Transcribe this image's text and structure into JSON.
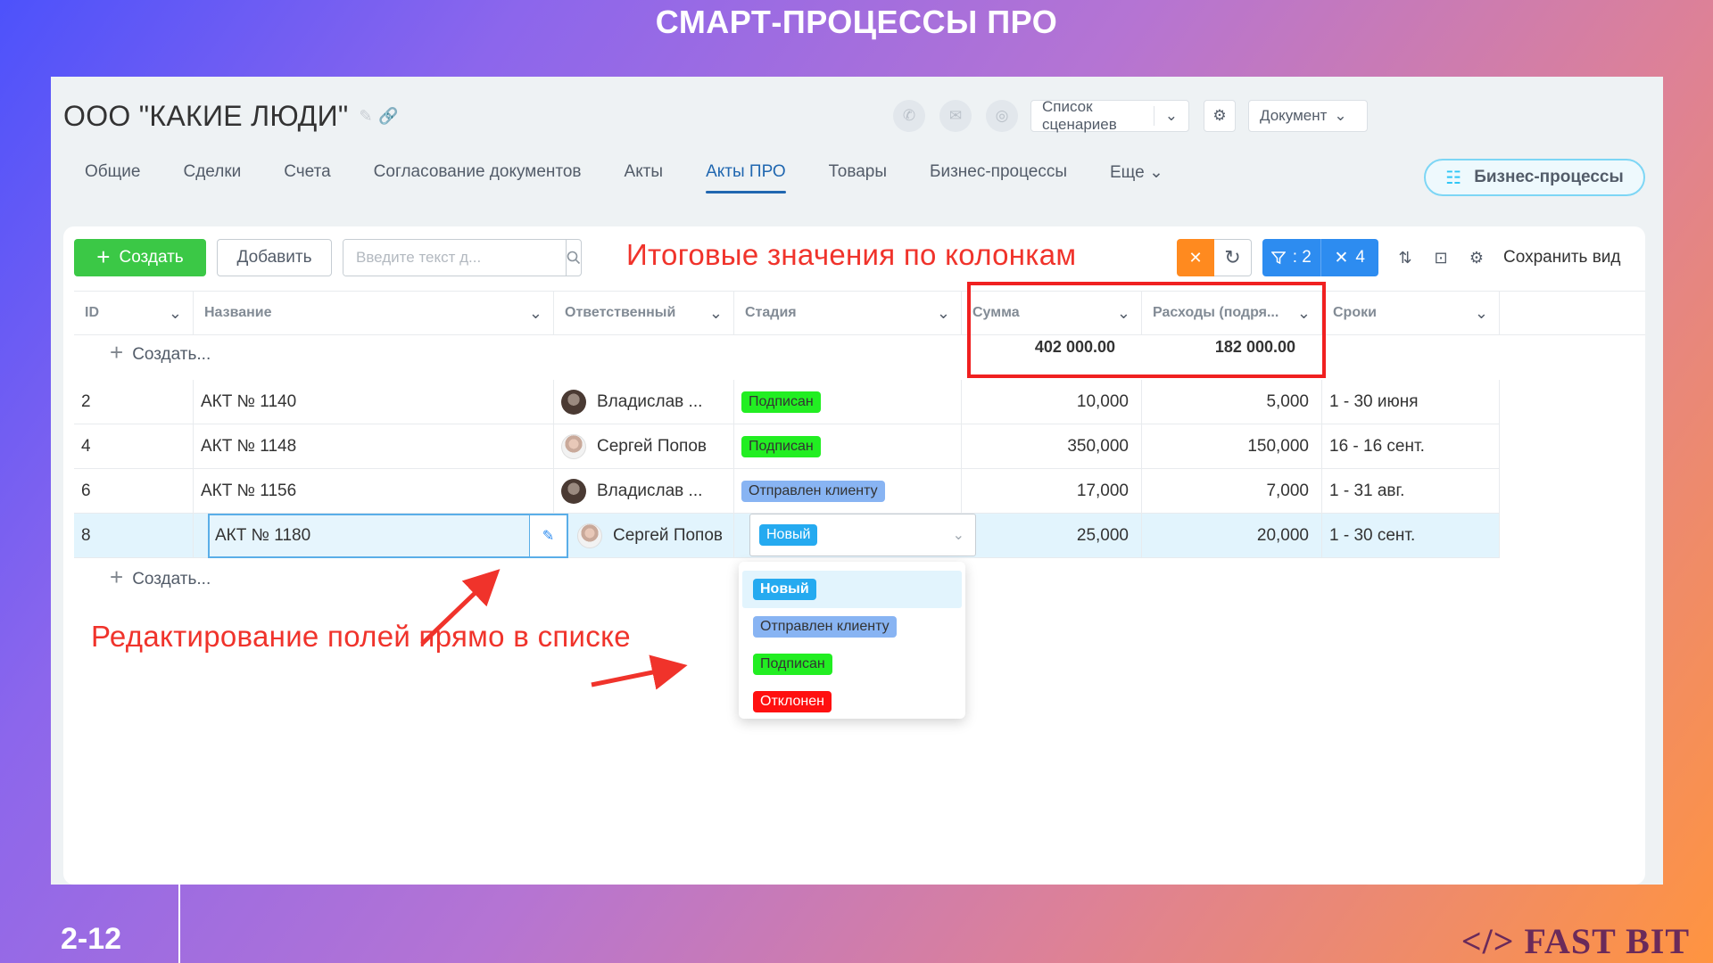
{
  "slide": {
    "title": "СМАРТ-ПРОЦЕССЫ ПРО",
    "page": "2-12",
    "brand": "</> FAST BIT"
  },
  "header": {
    "company": "ООО \"КАКИЕ ЛЮДИ\"",
    "scenarios_label": "Список сценариев",
    "document_label": "Документ",
    "icons": [
      "pencil-icon",
      "link-icon",
      "phone-icon",
      "mail-icon",
      "chat-icon",
      "gear-icon"
    ]
  },
  "tabs": [
    {
      "label": "Общие",
      "active": false
    },
    {
      "label": "Сделки",
      "active": false
    },
    {
      "label": "Счета",
      "active": false
    },
    {
      "label": "Согласование документов",
      "active": false
    },
    {
      "label": "Акты",
      "active": false
    },
    {
      "label": "Акты ПРО",
      "active": true
    },
    {
      "label": "Товары",
      "active": false
    },
    {
      "label": "Бизнес-процессы",
      "active": false
    },
    {
      "label": "Еще",
      "active": false
    }
  ],
  "bp_button": "Бизнес-процессы",
  "toolbar": {
    "create": "Создать",
    "add": "Добавить",
    "search_placeholder": "Введите текст д...",
    "filter_count": ": 2",
    "clear_count": "4",
    "save_view": "Сохранить вид"
  },
  "annotations": {
    "totals": "Итоговые значения по колонкам",
    "inline_edit": "Редактирование полей прямо в списке"
  },
  "columns": [
    "ID",
    "Название",
    "Ответственный",
    "Стадия",
    "Сумма",
    "Расходы (подря...",
    "Сроки"
  ],
  "create_row": "Создать...",
  "totals": {
    "sum": "402 000.00",
    "expenses": "182 000.00"
  },
  "rows": [
    {
      "id": "2",
      "name": "АКТ № 1140",
      "user": "Владислав ...",
      "stage": "Подписан",
      "stage_color": "#22ee22",
      "sum": "10,000",
      "exp": "5,000",
      "term": "1 - 30 июня"
    },
    {
      "id": "4",
      "name": "АКТ № 1148",
      "user": "Сергей Попов",
      "stage": "Подписан",
      "stage_color": "#22ee22",
      "sum": "350,000",
      "exp": "150,000",
      "term": "16 - 16 сент."
    },
    {
      "id": "6",
      "name": "АКТ № 1156",
      "user": "Владислав ...",
      "stage": "Отправлен клиенту",
      "stage_color": "#88b4f3",
      "sum": "17,000",
      "exp": "7,000",
      "term": "1 - 31 авг."
    },
    {
      "id": "8",
      "name": "АКТ № 1180",
      "user": "Сергей Попов",
      "stage": "Новый",
      "stage_color": "#25aaf0",
      "sum": "25,000",
      "exp": "20,000",
      "term": "1 - 30 сент."
    }
  ],
  "stage_options": [
    {
      "label": "Новый",
      "color": "#25aaf0",
      "text_color": "#ffffff"
    },
    {
      "label": "Отправлен клиенту",
      "color": "#88b4f3",
      "text_color": "#333333"
    },
    {
      "label": "Подписан",
      "color": "#22ee22",
      "text_color": "#333333"
    },
    {
      "label": "Отклонен",
      "color": "#ff1010",
      "text_color": "#ffffff"
    }
  ],
  "colors": {
    "accent": "#2067b0",
    "create_green": "#3bc846",
    "annotation_red": "#f0332b"
  }
}
